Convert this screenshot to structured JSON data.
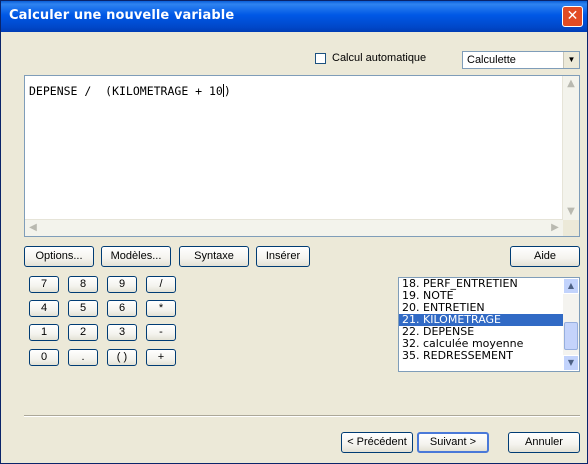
{
  "window": {
    "title": "Calculer une nouvelle variable",
    "close_glyph": "✕"
  },
  "toolbar": {
    "auto_calc_label": "Calcul automatique",
    "mode_select_value": "Calculette",
    "mode_arrow": "▼"
  },
  "editor": {
    "expression": "DEPENSE /  (KILOMETRAGE + 10",
    "expression_tail": ")"
  },
  "scroll": {
    "up": "▲",
    "down": "▼",
    "left": "◀",
    "right": "▶"
  },
  "buttons": {
    "options": "Options...",
    "models": "Modèles...",
    "syntax": "Syntaxe",
    "insert": "Insérer",
    "help": "Aide"
  },
  "keypad": [
    [
      "7",
      "8",
      "9",
      "/"
    ],
    [
      "4",
      "5",
      "6",
      "*"
    ],
    [
      "1",
      "2",
      "3",
      "-"
    ],
    [
      "0",
      ".",
      "( )",
      "+"
    ]
  ],
  "variables": {
    "items": [
      "18. PERF_ENTRETIEN",
      "19. NOTE",
      "20. ENTRETIEN",
      "21. KILOMETRAGE",
      "22. DEPENSE",
      "32. calculée moyenne",
      "35. REDRESSEMENT"
    ],
    "selected_index": 3
  },
  "footer": {
    "previous": "< Précédent",
    "next": "Suivant >",
    "cancel": "Annuler"
  }
}
